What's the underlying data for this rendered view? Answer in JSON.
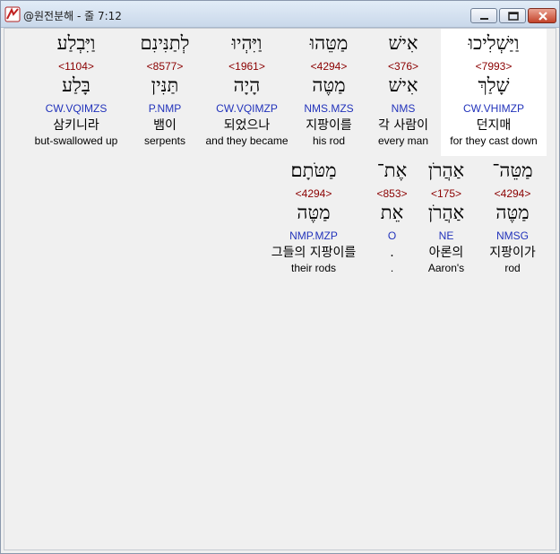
{
  "window": {
    "title": "@원전분해 - 줄 7:12",
    "icon": "app-icon"
  },
  "rows": [
    {
      "words": [
        {
          "hebrew": "וַיַּשְׁלִיכוּ",
          "strong": "<7993>",
          "lemma": "שָׁלַךְ",
          "morph": "CW.VHIMZP",
          "korean": "던지매",
          "english": "for they cast down",
          "highlighted": true
        },
        {
          "hebrew": "אִישׁ",
          "strong": "<376>",
          "lemma": "אִישׁ",
          "morph": "NMS",
          "korean": "각 사람이",
          "english": "every man"
        },
        {
          "hebrew": "מַטֵּהוּ",
          "strong": "<4294>",
          "lemma": "מַטֶּה",
          "morph": "NMS.MZS",
          "korean": "지팡이를",
          "english": "his rod"
        },
        {
          "hebrew": "וַיִּהְיוּ",
          "strong": "<1961>",
          "lemma": "הָיָה",
          "morph": "CW.VQIMZP",
          "korean": "되었으나",
          "english": "and they became"
        },
        {
          "hebrew": "לְתַנִּינִם",
          "strong": "<8577>",
          "lemma": "תַּנִּין",
          "morph": "P.NMP",
          "korean": "뱀이",
          "english": "serpents"
        },
        {
          "hebrew": "וַיִּבְלַע",
          "strong": "<1104>",
          "lemma": "בָּלַע",
          "morph": "CW.VQIMZS",
          "korean": "삼키니라",
          "english": "but-swallowed up"
        }
      ]
    },
    {
      "words": [
        {
          "hebrew": "מַטֵּה־",
          "strong": "<4294>",
          "lemma": "מַטֶּה",
          "morph": "NMSG",
          "korean": "지팡이가",
          "english": "rod"
        },
        {
          "hebrew": "אַהֲרֹן",
          "strong": "<175>",
          "lemma": "אַהֲרֹן",
          "morph": "NE",
          "korean": "아론의",
          "english": "Aaron's"
        },
        {
          "hebrew": "אֶת־",
          "strong": "<853>",
          "lemma": "אֵת",
          "morph": "O",
          "korean": ".",
          "english": "."
        },
        {
          "hebrew": "מַטֹּתָם׃",
          "strong": "<4294>",
          "lemma": "מַטֶּה",
          "morph": "NMP.MZP",
          "korean": "그들의 지팡이를",
          "english": "their rods"
        }
      ]
    }
  ]
}
